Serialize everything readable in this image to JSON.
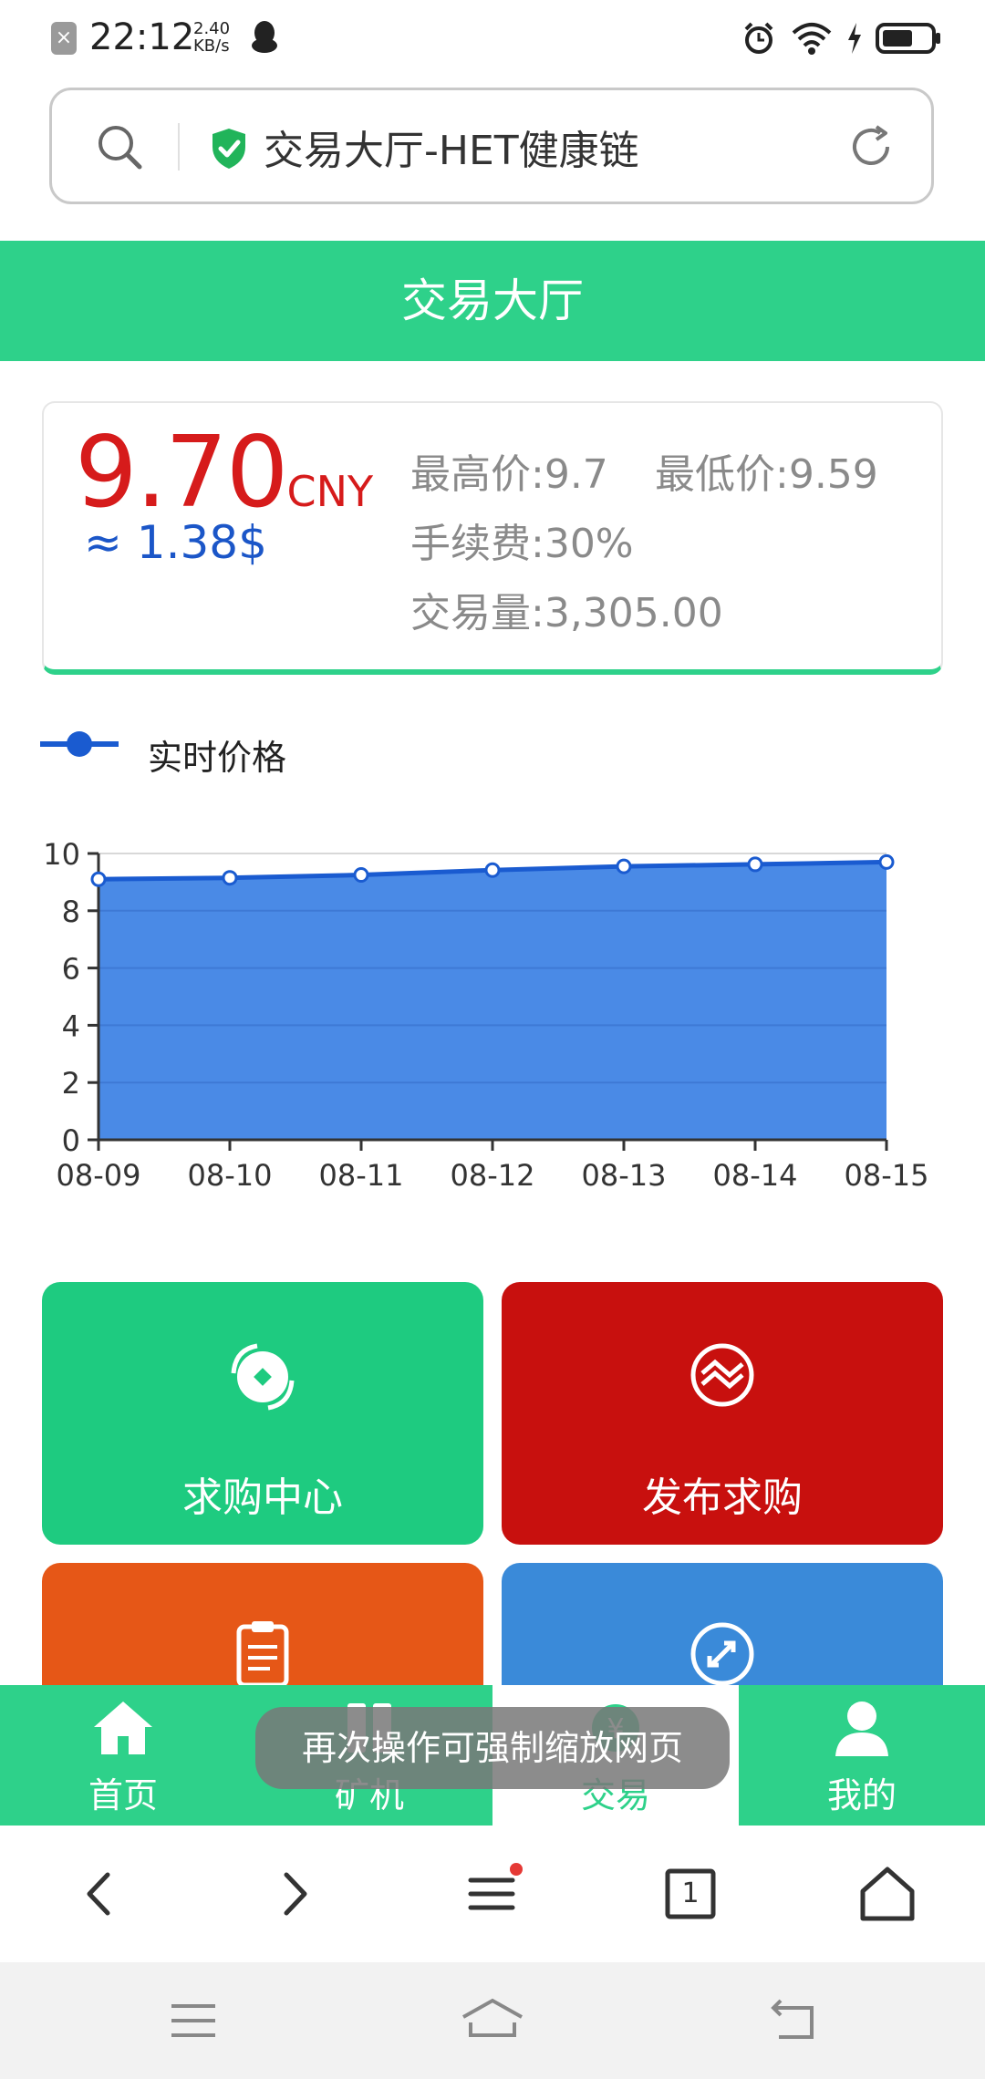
{
  "status_bar": {
    "time": "22:12",
    "speed_value": "2.40",
    "speed_unit": "KB/s"
  },
  "browser": {
    "page_title": "交易大厅-HET健康链"
  },
  "header": {
    "title": "交易大厅"
  },
  "price_card": {
    "price": "9.70",
    "currency": "CNY",
    "usd_price": "≈ 1.38$",
    "high": "最高价:9.7",
    "low": "最低价:9.59",
    "fee": "手续费:30%",
    "volume": "交易量:3,305.00"
  },
  "chart_data": {
    "type": "area",
    "series": [
      {
        "name": "实时价格",
        "values": [
          9.1,
          9.15,
          9.25,
          9.42,
          9.55,
          9.62,
          9.7
        ]
      }
    ],
    "categories": [
      "08-09",
      "08-10",
      "08-11",
      "08-12",
      "08-13",
      "08-14",
      "08-15"
    ],
    "ylim": [
      0,
      10
    ],
    "yticks": [
      "0",
      "2",
      "4",
      "6",
      "8",
      "10"
    ],
    "grid": true,
    "colors": {
      "fill": "#4a8ae6",
      "line": "#1a5bd0"
    }
  },
  "tiles": [
    {
      "label": "求购中心",
      "color": "#1ecb80",
      "icon": "coin-exchange-icon"
    },
    {
      "label": "发布求购",
      "color": "#c8100e",
      "icon": "swap-circle-icon"
    },
    {
      "label": "",
      "color": "#e65717",
      "icon": "clipboard-icon"
    },
    {
      "label": "",
      "color": "#3a8ad9",
      "icon": "exchange-arrows-icon"
    }
  ],
  "app_nav": [
    {
      "label": "首页",
      "icon": "home-icon"
    },
    {
      "label": "矿机",
      "icon": "miner-icon"
    },
    {
      "label": "交易",
      "icon": "trade-icon"
    },
    {
      "label": "我的",
      "icon": "user-icon"
    }
  ],
  "toast": {
    "text": "再次操作可强制缩放网页"
  },
  "browser_toolbar": {
    "tab_count": "1"
  }
}
